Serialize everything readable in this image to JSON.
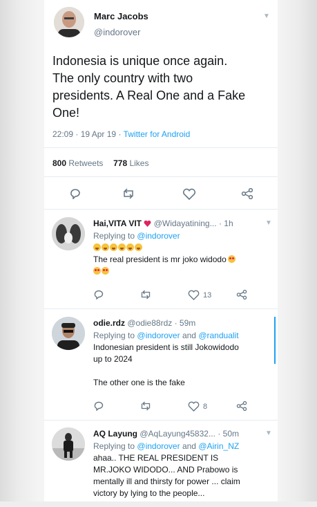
{
  "main_tweet": {
    "author_name": "Marc Jacobs",
    "author_handle": "@indorover",
    "text_lines": [
      "Indonesia is unique once again.",
      "The only country with two",
      "presidents. A Real One and a Fake",
      "One!"
    ],
    "time": "22:09",
    "date": "19 Apr 19",
    "separator": "·",
    "source": "Twitter for Android",
    "retweets_count": "800",
    "retweets_label": "Retweets",
    "likes_count": "778",
    "likes_label": "Likes"
  },
  "replies": [
    {
      "name": "Hai,VITA VIT",
      "handle": "@Widayatining...",
      "time": "· 1h",
      "replying_prefix": "Replying to",
      "replying_to": "@indorover",
      "replying_and": "",
      "replying_to2": "",
      "text_lines": [
        "The real president is mr joko widodo"
      ],
      "reply_count": "",
      "retweet_count": "",
      "like_count": "13"
    },
    {
      "name": "odie.rdz",
      "handle": "@odie88rdz",
      "time": "· 59m",
      "replying_prefix": "Replying to",
      "replying_to": "@indorover",
      "replying_and": "and",
      "replying_to2": "@randualit",
      "text_lines": [
        "Indonesian president is still Jokowidodo",
        "up to 2024",
        "",
        "The other one is the fake"
      ],
      "reply_count": "",
      "retweet_count": "",
      "like_count": "8"
    },
    {
      "name": "AQ Layung",
      "handle": "@AqLayung45832...",
      "time": "· 50m",
      "replying_prefix": "Replying to",
      "replying_to": "@indorover",
      "replying_and": "and",
      "replying_to2": "@Airin_NZ",
      "text_lines": [
        "ahaa.. THE REAL PRESIDENT IS",
        "MR.JOKO WIDODO... AND Prabowo is",
        "mentally ill and thirsty for power ... claim",
        "victory by lying to the people..."
      ]
    }
  ],
  "icons": [
    "chevron-down-icon",
    "reply-icon",
    "retweet-icon",
    "like-icon",
    "share-icon",
    "heart-emoji-icon",
    "laughing-emoji-icon",
    "heart-eyes-emoji-icon"
  ],
  "colors": {
    "link": "#1da1f2",
    "muted": "#657786",
    "text": "#14171a",
    "divider": "#e6ecf0",
    "heart": "#e0245e"
  }
}
